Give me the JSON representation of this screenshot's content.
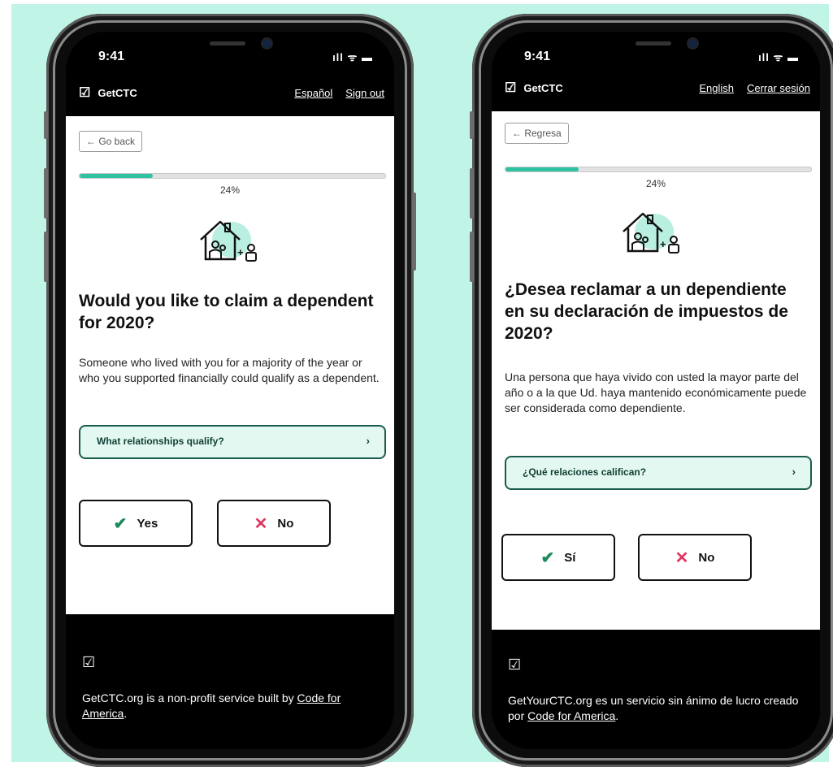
{
  "phones": {
    "left": {
      "time": "9:41",
      "status_icons": "ıll ᯤ ▬",
      "brand": "GetCTC",
      "lang_link": "Español",
      "signout_link": "Sign out",
      "back_label": "← Go back",
      "progress_percent": 24,
      "progress_label": "24%",
      "headline": "Would you like to claim a dependent for 2020?",
      "description": "Someone who lived with you for a majority of the year or who you supported financially could qualify as a dependent.",
      "accordion_label": "What relationships qualify?",
      "accordion_chevron": "›",
      "yes_label": "Yes",
      "no_label": "No",
      "footer_text": "GetCTC.org is a non-profit service built by ",
      "footer_link": "Code for America",
      "footer_end": "."
    },
    "right": {
      "time": "9:41",
      "status_icons": "ıll ᯤ ▬",
      "brand": "GetCTC",
      "lang_link": "English",
      "signout_link": "Cerrar sesión",
      "back_label": "← Regresa",
      "progress_percent": 24,
      "progress_label": "24%",
      "headline": "¿Desea reclamar a un dependiente en su declaración de impuestos de 2020?",
      "description": "Una persona que haya vivido con usted la mayor parte del año o a la que Ud. haya mantenido económicamente puede ser considerada como dependiente.",
      "accordion_label": "¿Qué relaciones califican?",
      "accordion_chevron": "›",
      "yes_label": "Sí",
      "no_label": "No",
      "footer_text": "GetYourCTC.org es un servicio sin ánimo de lucro creado por ",
      "footer_link": "Code for America",
      "footer_end": "."
    }
  },
  "icons": {
    "check_box": "☑",
    "yes": "✔",
    "no": "✕"
  },
  "colors": {
    "background": "#bff4e6",
    "accent": "#2fc2a2",
    "yes_icon": "#1f8a5c",
    "no_icon": "#e0365e",
    "accordion_border": "#1a5c4c"
  }
}
